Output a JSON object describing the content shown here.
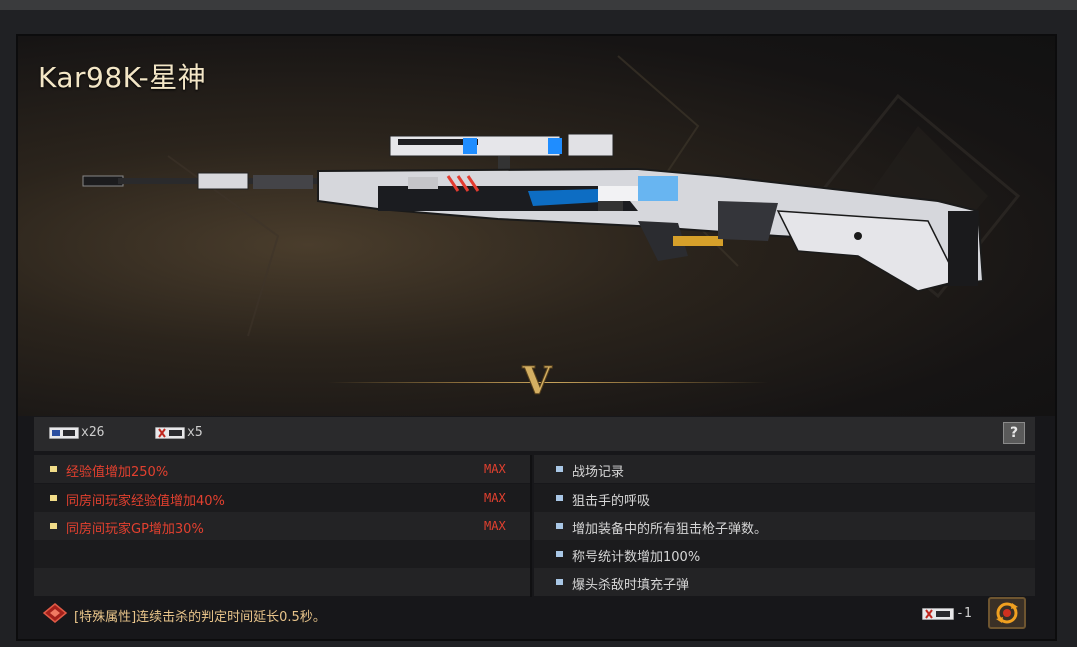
{
  "weapon": {
    "name": "Kar98K-星神",
    "rank": "V"
  },
  "currency": {
    "badge1_icon": "medal-badge-icon",
    "badge1_count": "x26",
    "badge2_icon": "cross-badge-icon",
    "badge2_count": "x5",
    "help_label": "?"
  },
  "attributes_left": [
    {
      "text": "经验值增加250%",
      "max": "MAX"
    },
    {
      "text": "同房间玩家经验值增加40%",
      "max": "MAX"
    },
    {
      "text": "同房间玩家GP增加30%",
      "max": "MAX"
    }
  ],
  "attributes_right": [
    {
      "text": "战场记录"
    },
    {
      "text": "狙击手的呼吸"
    },
    {
      "text": "增加装备中的所有狙击枪子弹数。"
    },
    {
      "text": "称号统计数增加100%"
    },
    {
      "text": "爆头杀敌时填充子弹"
    }
  ],
  "special": {
    "text": "[特殊属性]连续击杀的判定时间延长0.5秒。"
  },
  "cost": {
    "icon": "cross-badge-icon",
    "value": "-1"
  },
  "colors": {
    "title": "#f3e6c6",
    "attribute_red": "#e2402f",
    "rank_gold": "#c9a45c",
    "special_text": "#e8c48a"
  }
}
